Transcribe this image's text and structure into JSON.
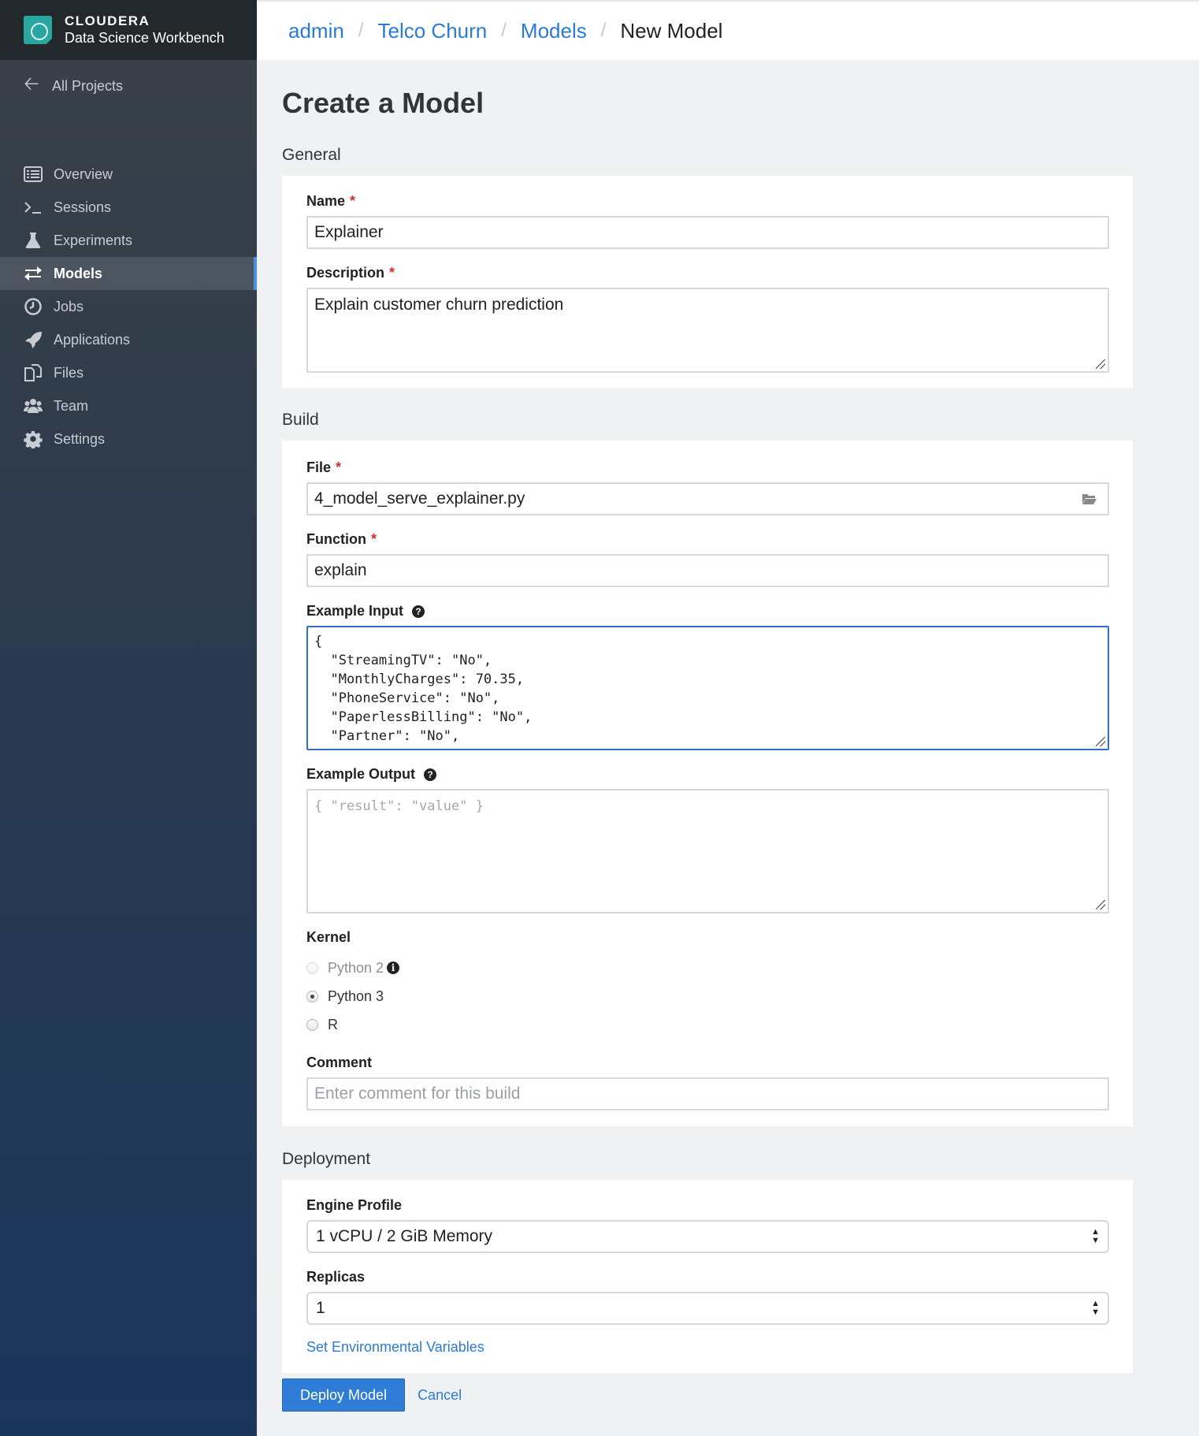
{
  "brand": {
    "name": "CLOUDERA",
    "product": "Data Science Workbench"
  },
  "sidebar": {
    "back_label": "All Projects",
    "items": [
      {
        "label": "Overview",
        "icon": "overview-icon"
      },
      {
        "label": "Sessions",
        "icon": "terminal-icon"
      },
      {
        "label": "Experiments",
        "icon": "flask-icon"
      },
      {
        "label": "Models",
        "icon": "exchange-arrows-icon",
        "active": true
      },
      {
        "label": "Jobs",
        "icon": "clock-icon"
      },
      {
        "label": "Applications",
        "icon": "rocket-icon"
      },
      {
        "label": "Files",
        "icon": "files-icon"
      },
      {
        "label": "Team",
        "icon": "team-icon"
      },
      {
        "label": "Settings",
        "icon": "gear-icon"
      }
    ]
  },
  "breadcrumb": [
    "admin",
    "Telco Churn",
    "Models",
    "New Model"
  ],
  "page": {
    "title": "Create a Model"
  },
  "general": {
    "section_title": "General",
    "name_label": "Name",
    "name_value": "Explainer",
    "description_label": "Description",
    "description_value": "Explain customer churn prediction"
  },
  "build": {
    "section_title": "Build",
    "file_label": "File",
    "file_value": "4_model_serve_explainer.py",
    "function_label": "Function",
    "function_value": "explain",
    "example_input_label": "Example Input",
    "example_input_value": "{\n  \"StreamingTV\": \"No\",\n  \"MonthlyCharges\": 70.35,\n  \"PhoneService\": \"No\",\n  \"PaperlessBilling\": \"No\",\n  \"Partner\": \"No\",",
    "example_output_label": "Example Output",
    "example_output_placeholder": "{ \"result\": \"value\" }",
    "kernel_label": "Kernel",
    "kernel_options": [
      {
        "label": "Python 2",
        "disabled": true
      },
      {
        "label": "Python 3",
        "checked": true
      },
      {
        "label": "R"
      }
    ],
    "comment_label": "Comment",
    "comment_placeholder": "Enter comment for this build"
  },
  "deployment": {
    "section_title": "Deployment",
    "engine_profile_label": "Engine Profile",
    "engine_profile_value": "1 vCPU / 2 GiB Memory",
    "replicas_label": "Replicas",
    "replicas_value": "1",
    "env_vars_link": "Set Environmental Variables"
  },
  "actions": {
    "deploy_label": "Deploy Model",
    "cancel_label": "Cancel"
  },
  "colors": {
    "accent": "#2f7dd6",
    "required": "#d0302f",
    "sidebar_dark": "#23282d"
  }
}
